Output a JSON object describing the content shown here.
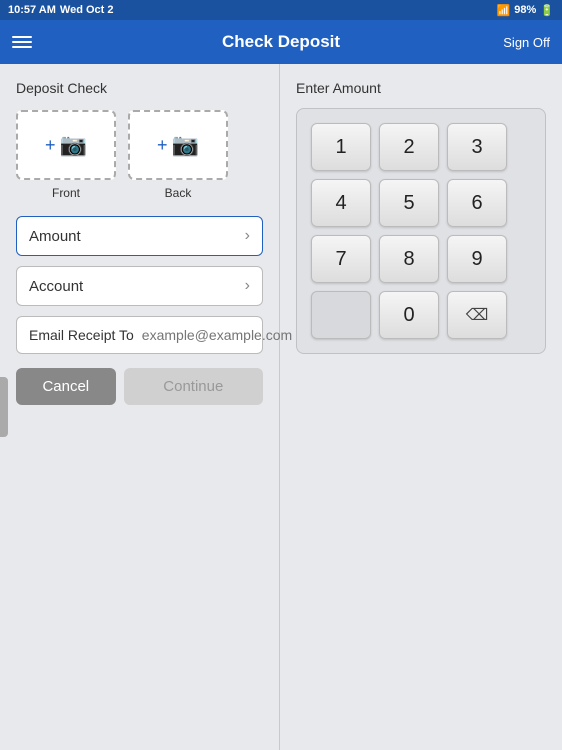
{
  "statusBar": {
    "time": "10:57 AM",
    "date": "Wed Oct 2",
    "wifi": "wifi",
    "battery": "98%"
  },
  "header": {
    "title": "Check Deposit",
    "signOff": "Sign Off"
  },
  "leftPanel": {
    "sectionTitle": "Deposit Check",
    "frontLabel": "Front",
    "backLabel": "Back",
    "amountLabel": "Amount",
    "accountLabel": "Account",
    "emailLabel": "Email Receipt To",
    "emailPlaceholder": "example@example.com",
    "cancelLabel": "Cancel",
    "continueLabel": "Continue"
  },
  "rightPanel": {
    "sectionTitle": "Enter Amount",
    "keys": [
      [
        "1",
        "2",
        "3"
      ],
      [
        "4",
        "5",
        "6"
      ],
      [
        "7",
        "8",
        "9"
      ],
      [
        "",
        "0",
        "⌫"
      ]
    ]
  }
}
